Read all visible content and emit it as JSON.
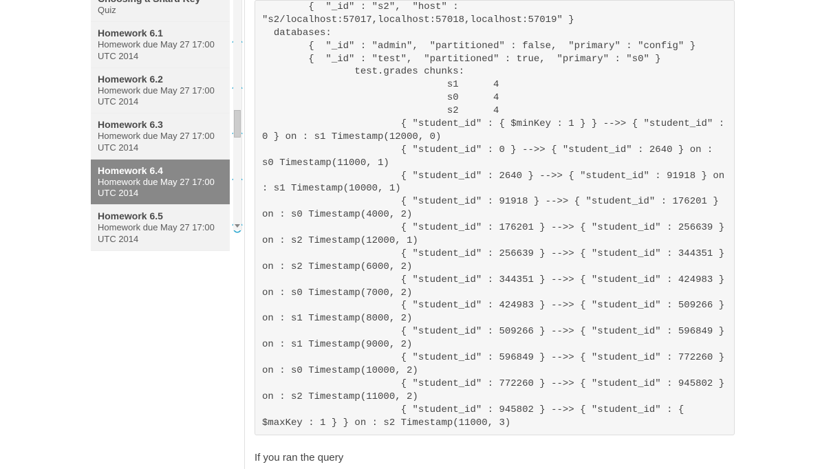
{
  "sidebar": {
    "items": [
      {
        "title": "Choosing a Shard Key",
        "sub": "Quiz",
        "has_clock": false,
        "active": false,
        "partial": true
      },
      {
        "title": "Homework 6.1",
        "sub": "Homework due May 27 17:00 UTC 2014",
        "has_clock": true,
        "active": false
      },
      {
        "title": "Homework 6.2",
        "sub": "Homework due May 27 17:00 UTC 2014",
        "has_clock": true,
        "active": false
      },
      {
        "title": "Homework 6.3",
        "sub": "Homework due May 27 17:00 UTC 2014",
        "has_clock": true,
        "active": false
      },
      {
        "title": "Homework 6.4",
        "sub": "Homework due May 27 17:00 UTC 2014",
        "has_clock": true,
        "active": true
      },
      {
        "title": "Homework 6.5",
        "sub": "Homework due May 27 17:00 UTC 2014",
        "has_clock": true,
        "active": false
      }
    ]
  },
  "code_output": "        {  \"_id\" : \"s2\",  \"host\" : \"s2/localhost:57017,localhost:57018,localhost:57019\" }\n  databases:\n        {  \"_id\" : \"admin\",  \"partitioned\" : false,  \"primary\" : \"config\" }\n        {  \"_id\" : \"test\",  \"partitioned\" : true,  \"primary\" : \"s0\" }\n                test.grades chunks:\n                                s1      4\n                                s0      4\n                                s2      4\n                        { \"student_id\" : { $minKey : 1 } } -->> { \"student_id\" : 0 } on : s1 Timestamp(12000, 0)\n                        { \"student_id\" : 0 } -->> { \"student_id\" : 2640 } on : s0 Timestamp(11000, 1)\n                        { \"student_id\" : 2640 } -->> { \"student_id\" : 91918 } on : s1 Timestamp(10000, 1)\n                        { \"student_id\" : 91918 } -->> { \"student_id\" : 176201 } on : s0 Timestamp(4000, 2)\n                        { \"student_id\" : 176201 } -->> { \"student_id\" : 256639 } on : s2 Timestamp(12000, 1)\n                        { \"student_id\" : 256639 } -->> { \"student_id\" : 344351 } on : s2 Timestamp(6000, 2)\n                        { \"student_id\" : 344351 } -->> { \"student_id\" : 424983 } on : s0 Timestamp(7000, 2)\n                        { \"student_id\" : 424983 } -->> { \"student_id\" : 509266 } on : s1 Timestamp(8000, 2)\n                        { \"student_id\" : 509266 } -->> { \"student_id\" : 596849 } on : s1 Timestamp(9000, 2)\n                        { \"student_id\" : 596849 } -->> { \"student_id\" : 772260 } on : s0 Timestamp(10000, 2)\n                        { \"student_id\" : 772260 } -->> { \"student_id\" : 945802 } on : s2 Timestamp(11000, 2)\n                        { \"student_id\" : 945802 } -->> { \"student_id\" : { $maxKey : 1 } } on : s2 Timestamp(11000, 3)",
  "follow_text": "If you ran the query",
  "colors": {
    "clock_icon": "#2aa7cf"
  }
}
